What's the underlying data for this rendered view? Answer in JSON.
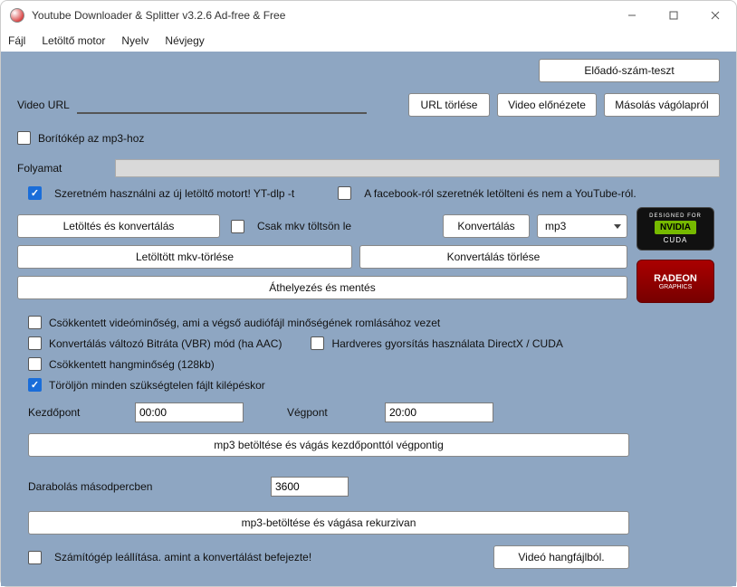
{
  "window": {
    "title": "Youtube Downloader & Splitter v3.2.6 Ad-free & Free"
  },
  "menu": {
    "file": "Fájl",
    "engine": "Letöltő motor",
    "lang": "Nyelv",
    "about": "Névjegy"
  },
  "buttons": {
    "artist_test": "Előadó-szám-teszt",
    "url_clear": "URL törlése",
    "video_preview": "Video előnézete",
    "paste_clipboard": "Másolás vágólapról",
    "download_convert": "Letöltés és konvertálás",
    "convert": "Konvertálás",
    "delete_mkv": "Letöltött mkv-törlése",
    "convert_clear": "Konvertálás törlése",
    "move_save": "Áthelyezés és mentés",
    "mp3_load_cut": "mp3 betöltése és vágás kezdőponttól végpontig",
    "mp3_recursive": "mp3-betöltése és vágása rekurzivan",
    "video_from_audio": "Videó hangfájlból."
  },
  "labels": {
    "video_url": "Video URL",
    "cover_mp3": "Borítókép az mp3-hoz",
    "process": "Folyamat",
    "use_new_engine": "Szeretném használni az új letöltő motort! YT-dlp -t",
    "facebook": "A facebook-ról szeretnék letölteni és nem a YouTube-ról.",
    "only_mkv": "Csak mkv töltsön le",
    "low_video": "Csökkentett videóminőség, ami a végső audiófájl minőségének romlásához vezet",
    "vbr": "Konvertálás változó Bitráta (VBR) mód (ha AAC)",
    "hw_accel": "Hardveres gyorsítás használata DirectX / CUDA",
    "low_audio": "Csökkentett hangminőség (128kb)",
    "delete_temp": "Töröljön minden szükségtelen fájlt kilépéskor",
    "start_point": "Kezdőpont",
    "end_point": "Végpont",
    "split_seconds": "Darabolás másodpercben",
    "shutdown": "Számítógép leállítása. amint a konvertálást befejezte!"
  },
  "values": {
    "url": "",
    "format": "mp3",
    "start": "00:00",
    "end": "20:00",
    "split": "3600"
  },
  "badges": {
    "nvidia_top": "DESIGNED FOR",
    "nvidia_mid": "NVIDIA",
    "nvidia_bot": "CUDA",
    "radeon_top": "RADEON",
    "radeon_bot": "GRAPHICS"
  }
}
